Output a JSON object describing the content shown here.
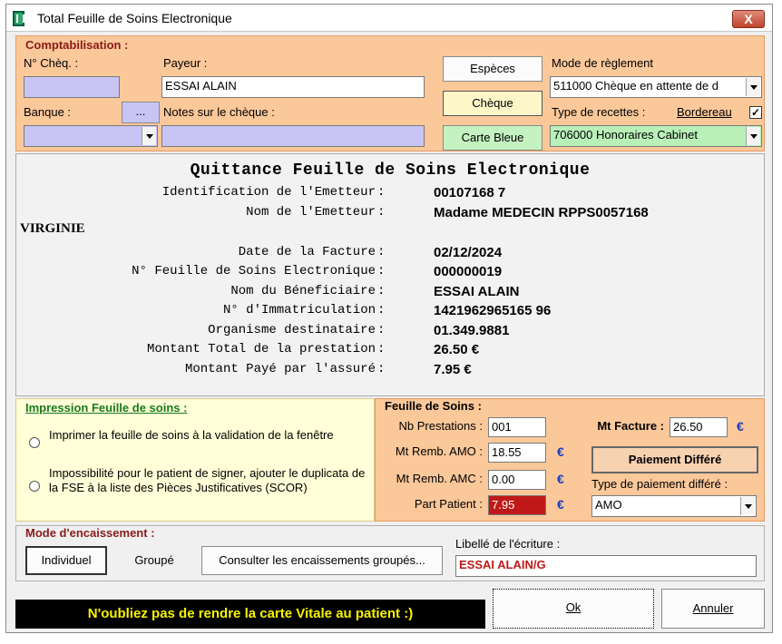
{
  "window": {
    "title": "Total Feuille de Soins Electronique",
    "close_label": "X"
  },
  "comptabilisation": {
    "title": "Comptabilisation :",
    "cheq_label": "N° Chèq. :",
    "cheq_value": "",
    "payeur_label": "Payeur :",
    "payeur_value": "ESSAI ALAIN",
    "banque_label": "Banque :",
    "banque_value": "",
    "banque_button": "...",
    "notes_label": "Notes sur le chèque :",
    "notes_value": "",
    "btn_especes": "Espèces",
    "btn_cheque": "Chèque",
    "btn_carte": "Carte Bleue",
    "mode_label": "Mode de règlement",
    "mode_value": "511000 Chèque en attente de d",
    "type_recettes_label": "Type de recettes :",
    "bordereau_label": "Bordereau",
    "bordereau_checked": "✓",
    "type_recettes_value": "706000 Honoraires Cabinet"
  },
  "receipt": {
    "title": "Quittance Feuille de Soins Electronique",
    "standalone": "VIRGINIE",
    "colon": ":",
    "rows": [
      {
        "label": "Identification de l'Emetteur",
        "value": "00107168 7"
      },
      {
        "label": "Nom de l'Emetteur",
        "value": "Madame MEDECIN RPPS0057168"
      },
      {
        "label": "Date de la Facture",
        "value": "02/12/2024"
      },
      {
        "label": "N° Feuille de Soins Electronique",
        "value": "000000019"
      },
      {
        "label": "Nom du Béneficiaire",
        "value": "ESSAI ALAIN"
      },
      {
        "label": "N° d'Immatriculation",
        "value": "1421962965165 96"
      },
      {
        "label": "Organisme destinataire",
        "value": "01.349.9881"
      },
      {
        "label": "Montant Total de la prestation",
        "value": "26.50 €"
      },
      {
        "label": "Montant Payé par l'assuré",
        "value": "7.95 €"
      }
    ]
  },
  "impression": {
    "title": "Impression Feuille de soins :",
    "option1": "Imprimer la feuille de soins à la validation de la fenêtre",
    "option2": "Impossibilité pour le patient de signer, ajouter le duplicata de la FSE à la liste des Pièces Justificatives (SCOR)"
  },
  "feuille_soins": {
    "title": "Feuille de Soins :",
    "nb_prestations_label": "Nb Prestations :",
    "nb_prestations_value": "001",
    "mt_amo_label": "Mt Remb. AMO :",
    "mt_amo_value": "18.55",
    "mt_amc_label": "Mt Remb. AMC :",
    "mt_amc_value": "0.00",
    "part_patient_label": "Part Patient :",
    "part_patient_value": "7.95",
    "mt_facture_label": "Mt Facture :",
    "mt_facture_value": "26.50",
    "euro": "€",
    "paiement_differe_button": "Paiement Différé",
    "type_paiement_label": "Type de paiement différé :",
    "type_paiement_value": "AMO"
  },
  "encaissement": {
    "title": "Mode d'encaissement :",
    "btn_individuel": "Individuel",
    "btn_groupe": "Groupé",
    "btn_consulter": "Consulter les encaissements groupés...",
    "libelle_label": "Libellé de l'écriture :",
    "libelle_value": "ESSAI ALAIN/G"
  },
  "footer": {
    "notice": "N'oubliez pas de rendre la carte Vitale au patient   :)",
    "ok_button": "Ok",
    "annuler_button": "Annuler"
  },
  "colors": {
    "orange_panel": "#fbc89a",
    "lavender_input": "#c8c4f4",
    "green_input": "#b8f0b8",
    "title_red": "#8a1a1a",
    "title_green": "#1a7a1a",
    "notice_text": "#f8f400"
  }
}
